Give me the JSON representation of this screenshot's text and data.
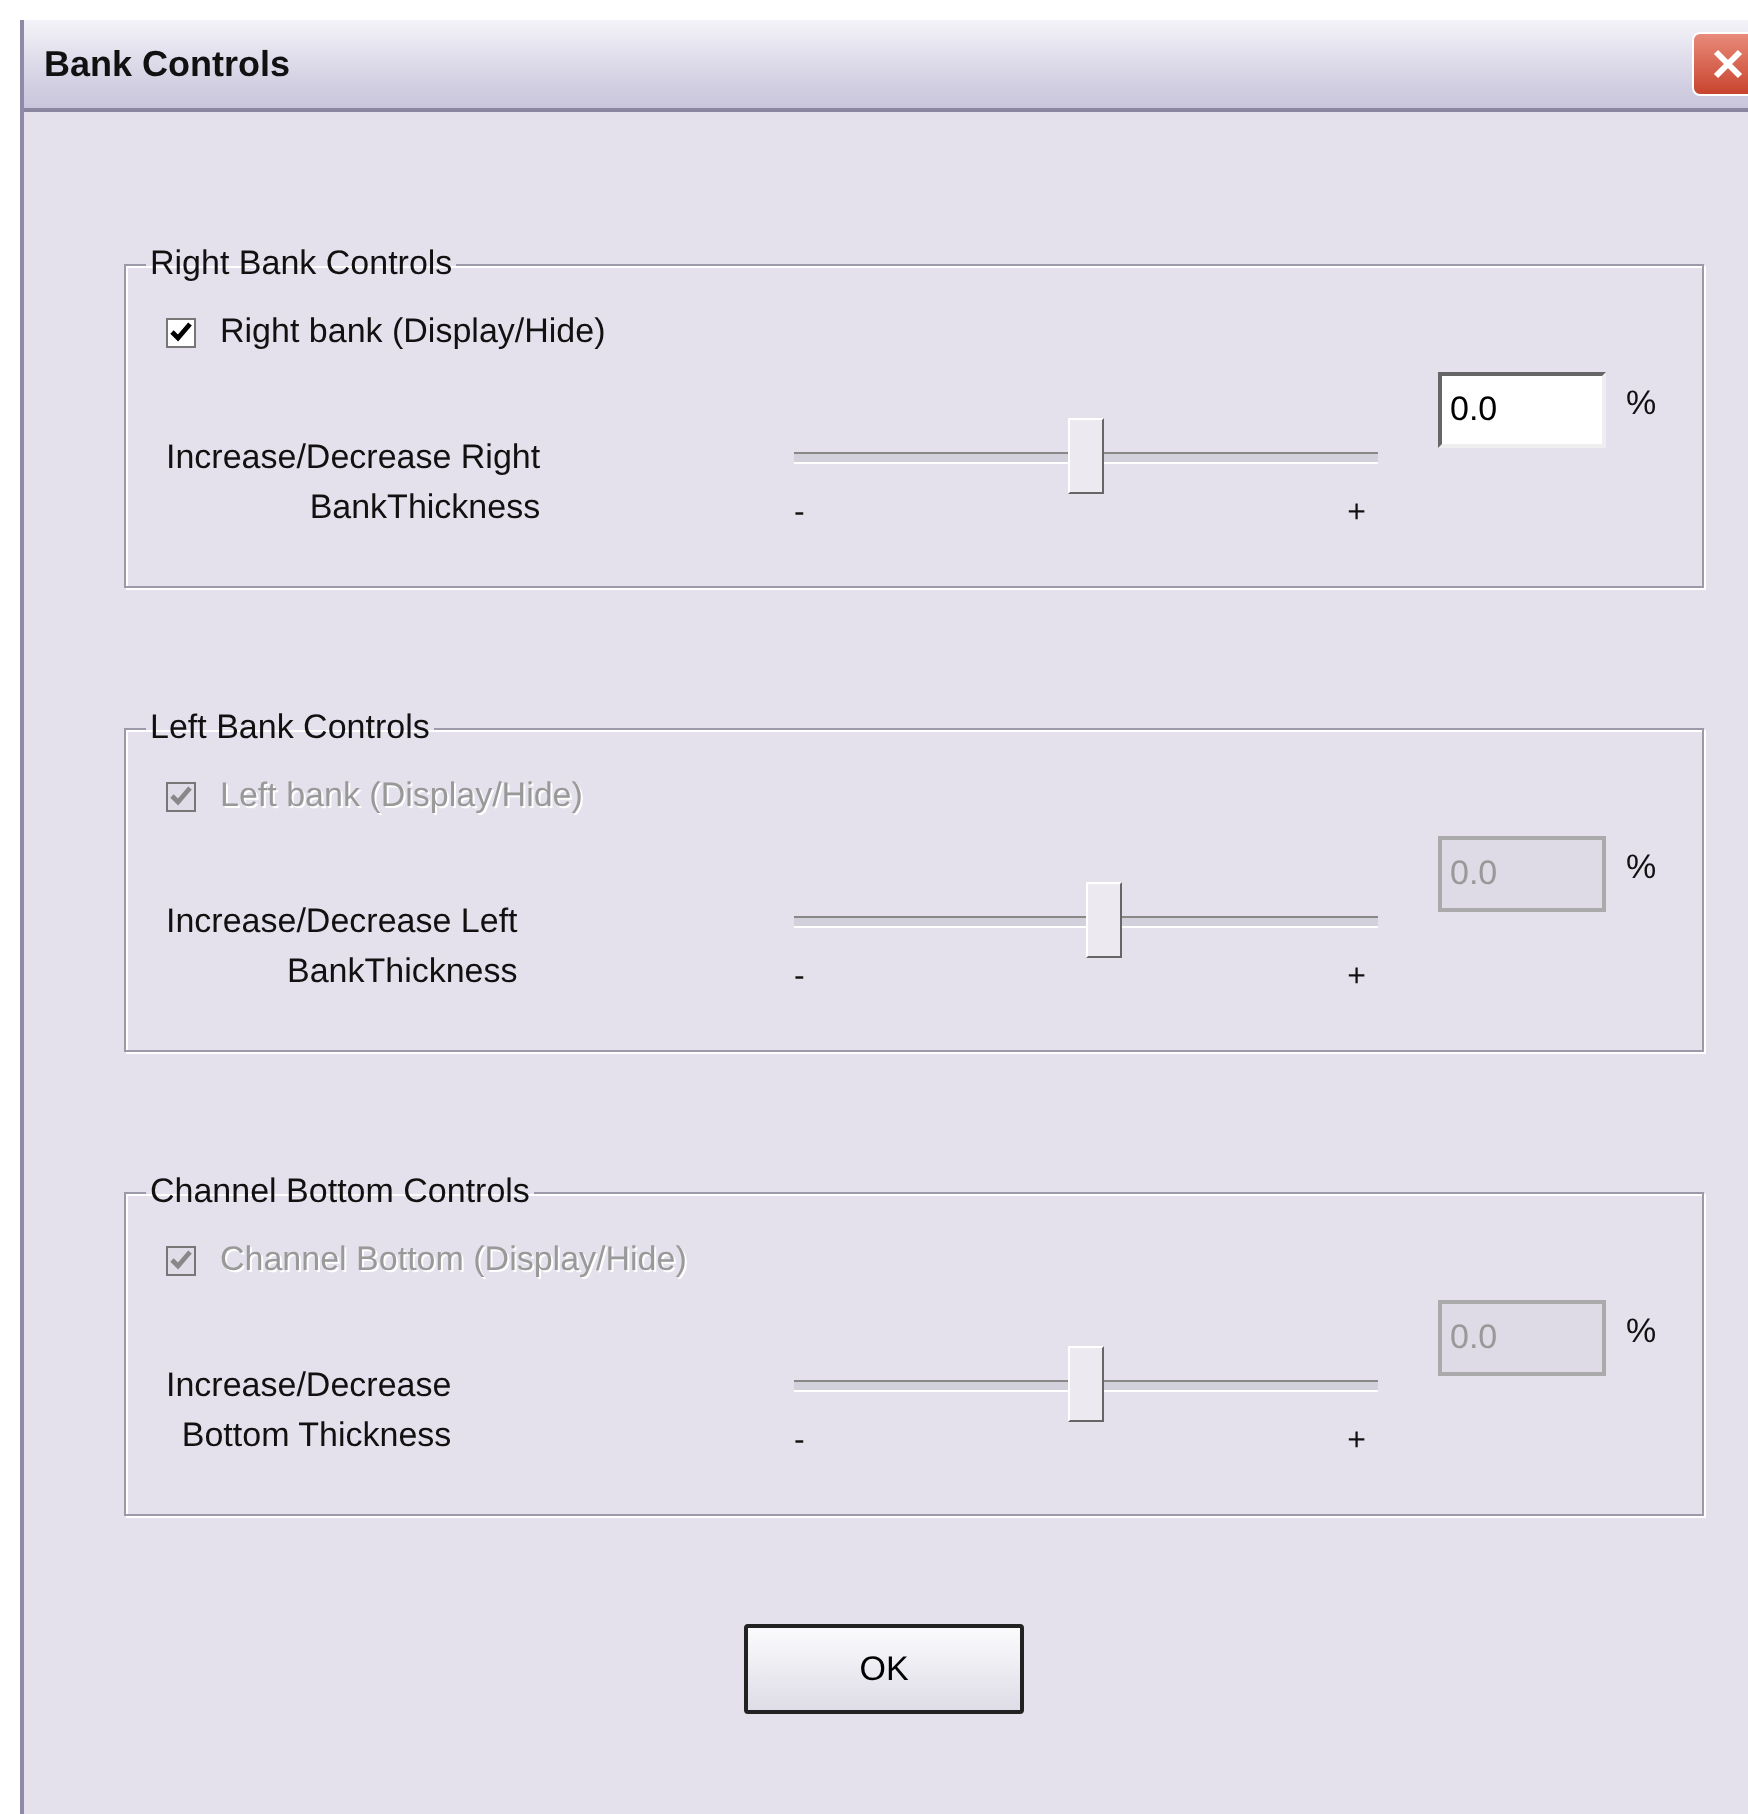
{
  "window": {
    "title": "Bank Controls"
  },
  "groups": [
    {
      "title": "Right Bank Controls",
      "checkbox": {
        "label": "Right bank (Display/Hide)",
        "checked": true,
        "disabled": false
      },
      "slider_label": "Increase/Decrease Right\nBankThickness",
      "min_label": "-",
      "max_label": "+",
      "level": 0.5,
      "value": "0.0",
      "unit": "%"
    },
    {
      "title": "Left Bank Controls",
      "checkbox": {
        "label": "Left bank (Display/Hide)",
        "checked": true,
        "disabled": true
      },
      "slider_label": "Increase/Decrease Left\nBankThickness",
      "min_label": "-",
      "max_label": "+",
      "level": 0.53,
      "value": "0.0",
      "unit": "%"
    },
    {
      "title": "Channel Bottom Controls",
      "checkbox": {
        "label": "Channel Bottom (Display/Hide)",
        "checked": true,
        "disabled": true
      },
      "slider_label": "Increase/Decrease\nBottom Thickness",
      "min_label": "-",
      "max_label": "+",
      "level": 0.5,
      "value": "0.0",
      "unit": "%"
    }
  ],
  "buttons": [
    "OK"
  ]
}
